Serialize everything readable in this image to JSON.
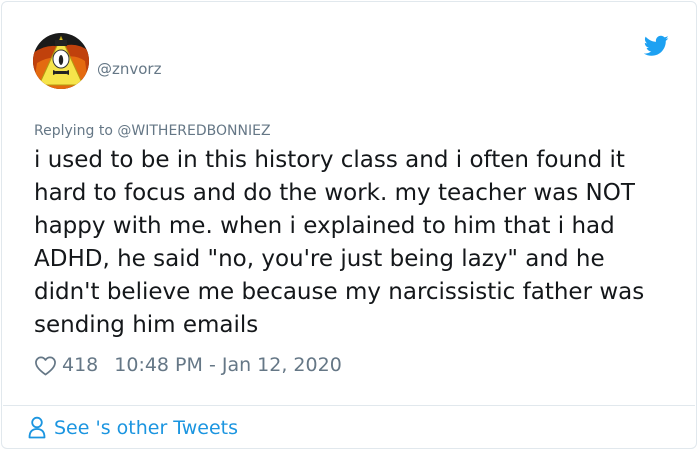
{
  "user": {
    "handle": "@znvorz"
  },
  "tweet": {
    "replying_prefix": "Replying to",
    "replying_to": "@WITHEREDBONNIEZ",
    "text": "i used to be in this history class and i often found it hard to focus and do the work. my teacher was NOT happy with me. when i explained to him that i had ADHD, he said \"no, you're just being lazy\" and he didn't believe me because my narcissistic father was sending him emails",
    "likes": "418",
    "timestamp": "10:48 PM - Jan 12, 2020"
  },
  "footer": {
    "see_other": "See 's other Tweets"
  },
  "colors": {
    "accent": "#1b95e0",
    "secondary_text": "#657786",
    "border": "#e1e8ed"
  },
  "icons": {
    "brand": "twitter-bird-icon",
    "like": "heart-icon",
    "profile": "person-icon"
  }
}
